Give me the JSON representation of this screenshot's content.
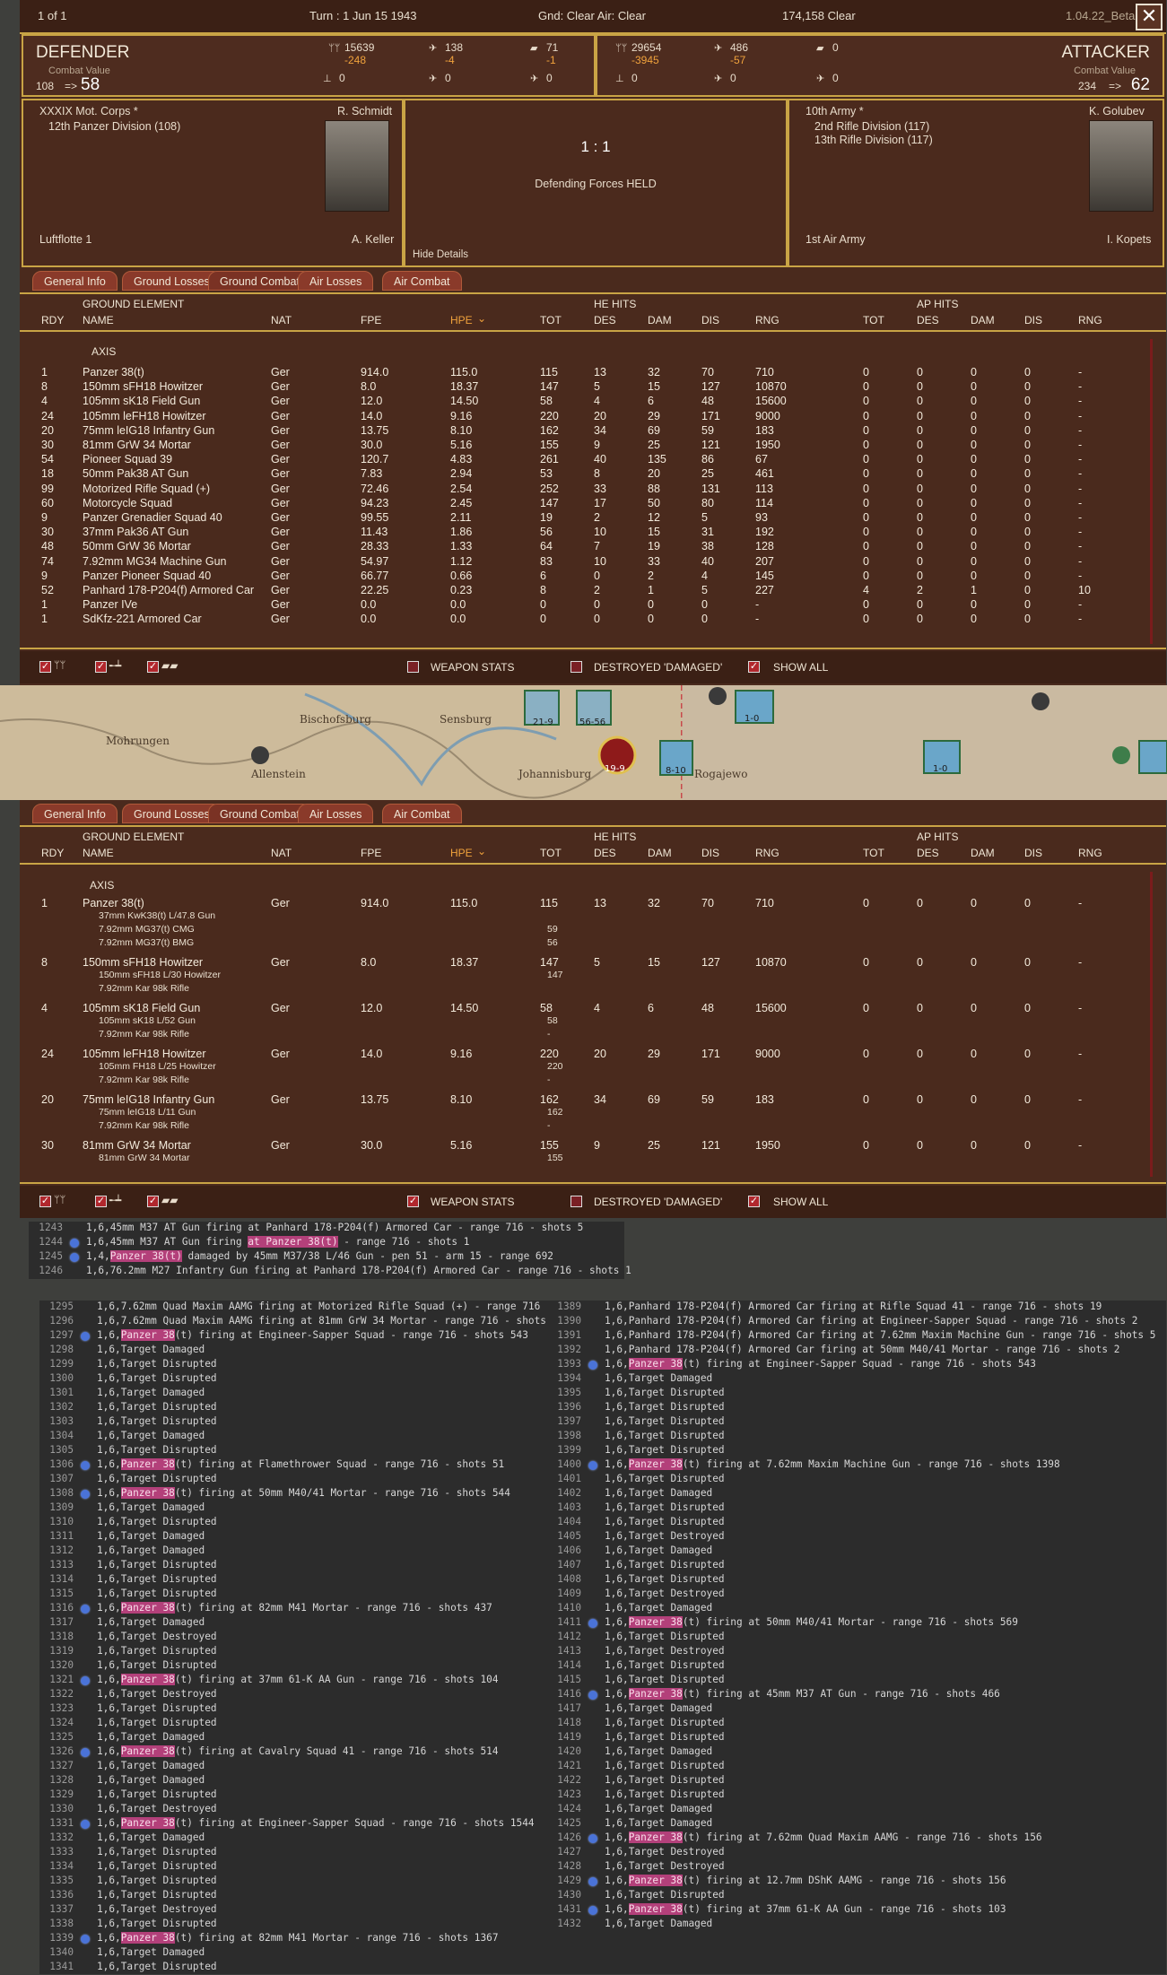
{
  "topbar": {
    "page": "1 of 1",
    "turn": "Turn : 1   Jun 15 1943",
    "weather": "Gnd: Clear  Air: Clear",
    "code": "174,158   Clear",
    "version": "1.04.22_Beta",
    "close": "✕"
  },
  "defender": {
    "title": "DEFENDER",
    "cv_label": "Combat Value",
    "cv_from": "108",
    "cv_arrow": "=>",
    "cv_to": "58",
    "men": "15639",
    "men_loss": "-248",
    "air": "138",
    "air_loss": "-4",
    "tank": "71",
    "tank_loss": "-1",
    "row2_a": "0",
    "row2_b": "0",
    "row2_c": "0",
    "corps": "XXXIX Mot. Corps *",
    "division": "12th Panzer Division (108)",
    "commander": "R. Schmidt",
    "air_unit": "Luftflotte 1",
    "air_commander": "A. Keller"
  },
  "attacker": {
    "title": "ATTACKER",
    "cv_label": "Combat Value",
    "cv_from": "234",
    "cv_arrow": "=>",
    "cv_to": "62",
    "men": "29654",
    "men_loss": "-3945",
    "air": "486",
    "air_loss": "-57",
    "tank": "0",
    "row2_a": "0",
    "row2_b": "0",
    "row2_c": "0",
    "army": "10th Army *",
    "div1": "2nd Rifle Division (117)",
    "div2": "13th Rifle Division (117)",
    "commander": "K. Golubev",
    "air_unit": "1st Air Army",
    "air_commander": "I. Kopets"
  },
  "center": {
    "odds": "1 : 1",
    "result": "Defending Forces HELD",
    "hide": "Hide Details"
  },
  "tabs": [
    "General Info",
    "Ground Losses",
    "Ground Combat",
    "Air Losses",
    "Air Combat"
  ],
  "table_headers": {
    "ground_element": "GROUND ELEMENT",
    "he_hits": "HE HITS",
    "ap_hits": "AP HITS",
    "cols": [
      "RDY",
      "NAME",
      "NAT",
      "FPE",
      "HPE",
      "TOT",
      "DES",
      "DAM",
      "DIS",
      "RNG",
      "TOT",
      "DES",
      "DAM",
      "DIS",
      "RNG"
    ],
    "hpe_sort": "⌄"
  },
  "side_label": "AXIS",
  "table1_rows": [
    [
      "1",
      "Panzer 38(t)",
      "Ger",
      "914.0",
      "115.0",
      "115",
      "13",
      "32",
      "70",
      "710",
      "0",
      "0",
      "0",
      "0",
      "-"
    ],
    [
      "8",
      "150mm sFH18 Howitzer",
      "Ger",
      "8.0",
      "18.37",
      "147",
      "5",
      "15",
      "127",
      "10870",
      "0",
      "0",
      "0",
      "0",
      "-"
    ],
    [
      "4",
      "105mm sK18 Field Gun",
      "Ger",
      "12.0",
      "14.50",
      "58",
      "4",
      "6",
      "48",
      "15600",
      "0",
      "0",
      "0",
      "0",
      "-"
    ],
    [
      "24",
      "105mm leFH18 Howitzer",
      "Ger",
      "14.0",
      "9.16",
      "220",
      "20",
      "29",
      "171",
      "9000",
      "0",
      "0",
      "0",
      "0",
      "-"
    ],
    [
      "20",
      "75mm leIG18 Infantry Gun",
      "Ger",
      "13.75",
      "8.10",
      "162",
      "34",
      "69",
      "59",
      "183",
      "0",
      "0",
      "0",
      "0",
      "-"
    ],
    [
      "30",
      "81mm GrW 34 Mortar",
      "Ger",
      "30.0",
      "5.16",
      "155",
      "9",
      "25",
      "121",
      "1950",
      "0",
      "0",
      "0",
      "0",
      "-"
    ],
    [
      "54",
      "Pioneer Squad 39",
      "Ger",
      "120.7",
      "4.83",
      "261",
      "40",
      "135",
      "86",
      "67",
      "0",
      "0",
      "0",
      "0",
      "-"
    ],
    [
      "18",
      "50mm Pak38 AT Gun",
      "Ger",
      "7.83",
      "2.94",
      "53",
      "8",
      "20",
      "25",
      "461",
      "0",
      "0",
      "0",
      "0",
      "-"
    ],
    [
      "99",
      "Motorized Rifle Squad (+)",
      "Ger",
      "72.46",
      "2.54",
      "252",
      "33",
      "88",
      "131",
      "113",
      "0",
      "0",
      "0",
      "0",
      "-"
    ],
    [
      "60",
      "Motorcycle Squad",
      "Ger",
      "94.23",
      "2.45",
      "147",
      "17",
      "50",
      "80",
      "114",
      "0",
      "0",
      "0",
      "0",
      "-"
    ],
    [
      "9",
      "Panzer Grenadier Squad 40",
      "Ger",
      "99.55",
      "2.11",
      "19",
      "2",
      "12",
      "5",
      "93",
      "0",
      "0",
      "0",
      "0",
      "-"
    ],
    [
      "30",
      "37mm Pak36 AT Gun",
      "Ger",
      "11.43",
      "1.86",
      "56",
      "10",
      "15",
      "31",
      "192",
      "0",
      "0",
      "0",
      "0",
      "-"
    ],
    [
      "48",
      "50mm GrW 36 Mortar",
      "Ger",
      "28.33",
      "1.33",
      "64",
      "7",
      "19",
      "38",
      "128",
      "0",
      "0",
      "0",
      "0",
      "-"
    ],
    [
      "74",
      "7.92mm MG34 Machine Gun",
      "Ger",
      "54.97",
      "1.12",
      "83",
      "10",
      "33",
      "40",
      "207",
      "0",
      "0",
      "0",
      "0",
      "-"
    ],
    [
      "9",
      "Panzer Pioneer Squad 40",
      "Ger",
      "66.77",
      "0.66",
      "6",
      "0",
      "2",
      "4",
      "145",
      "0",
      "0",
      "0",
      "0",
      "-"
    ],
    [
      "52",
      "Panhard 178-P204(f) Armored Car",
      "Ger",
      "22.25",
      "0.23",
      "8",
      "2",
      "1",
      "5",
      "227",
      "4",
      "2",
      "1",
      "0",
      "10"
    ],
    [
      "1",
      "Panzer IVe",
      "Ger",
      "0.0",
      "0.0",
      "0",
      "0",
      "0",
      "0",
      "-",
      "0",
      "0",
      "0",
      "0",
      "-"
    ],
    [
      "1",
      "SdKfz-221 Armored Car",
      "Ger",
      "0.0",
      "0.0",
      "0",
      "0",
      "0",
      "0",
      "-",
      "0",
      "0",
      "0",
      "0",
      "-"
    ]
  ],
  "table2_rows": [
    {
      "main": [
        "1",
        "Panzer 38(t)",
        "Ger",
        "914.0",
        "115.0",
        "115",
        "13",
        "32",
        "70",
        "710",
        "0",
        "0",
        "0",
        "0",
        "-"
      ],
      "subs": [
        [
          "37mm KwK38(t) L/47.8 Gun",
          "",
          ""
        ],
        [
          "7.92mm MG37(t) CMG",
          "59",
          ""
        ],
        [
          "7.92mm MG37(t) BMG",
          "56",
          ""
        ]
      ]
    },
    {
      "main": [
        "8",
        "150mm sFH18 Howitzer",
        "Ger",
        "8.0",
        "18.37",
        "147",
        "5",
        "15",
        "127",
        "10870",
        "0",
        "0",
        "0",
        "0",
        "-"
      ],
      "subs": [
        [
          "150mm sFH18 L/30 Howitzer",
          "147",
          ""
        ],
        [
          "7.92mm Kar 98k Rifle",
          "",
          ""
        ]
      ]
    },
    {
      "main": [
        "4",
        "105mm sK18 Field Gun",
        "Ger",
        "12.0",
        "14.50",
        "58",
        "4",
        "6",
        "48",
        "15600",
        "0",
        "0",
        "0",
        "0",
        "-"
      ],
      "subs": [
        [
          "105mm sK18 L/52 Gun",
          "58",
          ""
        ],
        [
          "7.92mm Kar 98k Rifle",
          "-",
          ""
        ]
      ]
    },
    {
      "main": [
        "24",
        "105mm leFH18 Howitzer",
        "Ger",
        "14.0",
        "9.16",
        "220",
        "20",
        "29",
        "171",
        "9000",
        "0",
        "0",
        "0",
        "0",
        "-"
      ],
      "subs": [
        [
          "105mm FH18 L/25 Howitzer",
          "220",
          ""
        ],
        [
          "7.92mm Kar 98k Rifle",
          "-",
          ""
        ]
      ]
    },
    {
      "main": [
        "20",
        "75mm leIG18 Infantry Gun",
        "Ger",
        "13.75",
        "8.10",
        "162",
        "34",
        "69",
        "59",
        "183",
        "0",
        "0",
        "0",
        "0",
        "-"
      ],
      "subs": [
        [
          "75mm leIG18 L/11 Gun",
          "162",
          ""
        ],
        [
          "7.92mm Kar 98k Rifle",
          "-",
          ""
        ]
      ]
    },
    {
      "main": [
        "30",
        "81mm GrW 34 Mortar",
        "Ger",
        "30.0",
        "5.16",
        "155",
        "9",
        "25",
        "121",
        "1950",
        "0",
        "0",
        "0",
        "0",
        "-"
      ],
      "subs": [
        [
          "81mm GrW 34 Mortar",
          "155",
          ""
        ]
      ]
    }
  ],
  "footer": {
    "weapon_stats": "WEAPON STATS",
    "destroyed": "DESTROYED 'DAMAGED'",
    "show_all": "SHOW ALL"
  },
  "map": {
    "cities": [
      "Bischofsburg",
      "Sensburg",
      "Allenstein",
      "Johannisburg",
      "Mohrungen",
      "Rogajewo"
    ],
    "units": [
      "21-9",
      "56-56",
      "19-9",
      "8-10",
      "1-0",
      "1-0"
    ]
  },
  "log_small": [
    {
      "n": "1243",
      "bp": false,
      "t": "1,6,45mm M37 AT Gun firing at Panhard 178-P204(f) Armored Car - range 716 - shots 5"
    },
    {
      "n": "1244",
      "bp": true,
      "t": "1,6,45mm M37 AT Gun firing at Panzer 38(t) - range 716 - shots 1",
      "hl": "at Panzer 38(t)"
    },
    {
      "n": "1245",
      "bp": true,
      "t": "1,4,Panzer 38(t) damaged by 45mm M37/38 L/46 Gun - pen 51 - arm 15 - range 692",
      "hl": "Panzer 38(t)"
    },
    {
      "n": "1246",
      "bp": false,
      "t": "1,6,76.2mm M27 Infantry Gun firing at Panhard 178-P204(f) Armored Car - range 716 - shots 1"
    }
  ],
  "log_left": [
    {
      "n": "1295",
      "bp": false,
      "t": "1,6,7.62mm Quad Maxim AAMG firing at Motorized Rifle Squad (+) - range 716 -"
    },
    {
      "n": "1296",
      "bp": false,
      "t": "1,6,7.62mm Quad Maxim AAMG firing at 81mm GrW 34 Mortar - range 716 - shots"
    },
    {
      "n": "1297",
      "bp": true,
      "t": "1,6,Panzer 38(t) firing at Engineer-Sapper Squad - range 716 - shots 543",
      "hl": "Panzer 38"
    },
    {
      "n": "1298",
      "bp": false,
      "t": "1,6,Target Damaged"
    },
    {
      "n": "1299",
      "bp": false,
      "t": "1,6,Target Disrupted"
    },
    {
      "n": "1300",
      "bp": false,
      "t": "1,6,Target Disrupted"
    },
    {
      "n": "1301",
      "bp": false,
      "t": "1,6,Target Damaged"
    },
    {
      "n": "1302",
      "bp": false,
      "t": "1,6,Target Disrupted"
    },
    {
      "n": "1303",
      "bp": false,
      "t": "1,6,Target Disrupted"
    },
    {
      "n": "1304",
      "bp": false,
      "t": "1,6,Target Damaged"
    },
    {
      "n": "1305",
      "bp": false,
      "t": "1,6,Target Disrupted"
    },
    {
      "n": "1306",
      "bp": true,
      "t": "1,6,Panzer 38(t) firing at Flamethrower Squad - range 716 - shots 51",
      "hl": "Panzer 38"
    },
    {
      "n": "1307",
      "bp": false,
      "t": "1,6,Target Disrupted"
    },
    {
      "n": "1308",
      "bp": true,
      "t": "1,6,Panzer 38(t) firing at 50mm M40/41 Mortar - range 716 - shots 544",
      "hl": "Panzer 38"
    },
    {
      "n": "1309",
      "bp": false,
      "t": "1,6,Target Damaged"
    },
    {
      "n": "1310",
      "bp": false,
      "t": "1,6,Target Disrupted"
    },
    {
      "n": "1311",
      "bp": false,
      "t": "1,6,Target Damaged"
    },
    {
      "n": "1312",
      "bp": false,
      "t": "1,6,Target Damaged"
    },
    {
      "n": "1313",
      "bp": false,
      "t": "1,6,Target Disrupted"
    },
    {
      "n": "1314",
      "bp": false,
      "t": "1,6,Target Disrupted"
    },
    {
      "n": "1315",
      "bp": false,
      "t": "1,6,Target Disrupted"
    },
    {
      "n": "1316",
      "bp": true,
      "t": "1,6,Panzer 38(t) firing at 82mm M41 Mortar - range 716 - shots 437",
      "hl": "Panzer 38"
    },
    {
      "n": "1317",
      "bp": false,
      "t": "1,6,Target Damaged"
    },
    {
      "n": "1318",
      "bp": false,
      "t": "1,6,Target Destroyed"
    },
    {
      "n": "1319",
      "bp": false,
      "t": "1,6,Target Disrupted"
    },
    {
      "n": "1320",
      "bp": false,
      "t": "1,6,Target Disrupted"
    },
    {
      "n": "1321",
      "bp": true,
      "t": "1,6,Panzer 38(t) firing at 37mm 61-K AA Gun - range 716 - shots 104",
      "hl": "Panzer 38"
    },
    {
      "n": "1322",
      "bp": false,
      "t": "1,6,Target Destroyed"
    },
    {
      "n": "1323",
      "bp": false,
      "t": "1,6,Target Disrupted"
    },
    {
      "n": "1324",
      "bp": false,
      "t": "1,6,Target Disrupted"
    },
    {
      "n": "1325",
      "bp": false,
      "t": "1,6,Target Damaged"
    },
    {
      "n": "1326",
      "bp": true,
      "t": "1,6,Panzer 38(t) firing at Cavalry Squad 41 - range 716 - shots 514",
      "hl": "Panzer 38"
    },
    {
      "n": "1327",
      "bp": false,
      "t": "1,6,Target Damaged"
    },
    {
      "n": "1328",
      "bp": false,
      "t": "1,6,Target Damaged"
    },
    {
      "n": "1329",
      "bp": false,
      "t": "1,6,Target Disrupted"
    },
    {
      "n": "1330",
      "bp": false,
      "t": "1,6,Target Destroyed"
    },
    {
      "n": "1331",
      "bp": true,
      "t": "1,6,Panzer 38(t) firing at Engineer-Sapper Squad - range 716 - shots 1544",
      "hl": "Panzer 38"
    },
    {
      "n": "1332",
      "bp": false,
      "t": "1,6,Target Damaged"
    },
    {
      "n": "1333",
      "bp": false,
      "t": "1,6,Target Disrupted"
    },
    {
      "n": "1334",
      "bp": false,
      "t": "1,6,Target Disrupted"
    },
    {
      "n": "1335",
      "bp": false,
      "t": "1,6,Target Disrupted"
    },
    {
      "n": "1336",
      "bp": false,
      "t": "1,6,Target Disrupted"
    },
    {
      "n": "1337",
      "bp": false,
      "t": "1,6,Target Destroyed"
    },
    {
      "n": "1338",
      "bp": false,
      "t": "1,6,Target Disrupted"
    },
    {
      "n": "1339",
      "bp": true,
      "t": "1,6,Panzer 38(t) firing at 82mm M41 Mortar - range 716 - shots 1367",
      "hl": "Panzer 38"
    },
    {
      "n": "1340",
      "bp": false,
      "t": "1,6,Target Damaged"
    },
    {
      "n": "1341",
      "bp": false,
      "t": "1,6,Target Disrupted"
    }
  ],
  "log_right": [
    {
      "n": "1389",
      "bp": false,
      "t": "1,6,Panhard 178-P204(f) Armored Car firing at Rifle Squad 41 - range 716 - shots 19"
    },
    {
      "n": "1390",
      "bp": false,
      "t": "1,6,Panhard 178-P204(f) Armored Car firing at Engineer-Sapper Squad - range 716 - shots 2"
    },
    {
      "n": "1391",
      "bp": false,
      "t": "1,6,Panhard 178-P204(f) Armored Car firing at 7.62mm Maxim Machine Gun - range 716 - shots 5"
    },
    {
      "n": "1392",
      "bp": false,
      "t": "1,6,Panhard 178-P204(f) Armored Car firing at 50mm M40/41 Mortar - range 716 - shots 2"
    },
    {
      "n": "1393",
      "bp": true,
      "t": "1,6,Panzer 38(t) firing at Engineer-Sapper Squad - range 716 - shots 543",
      "hl": "Panzer 38"
    },
    {
      "n": "1394",
      "bp": false,
      "t": "1,6,Target Damaged"
    },
    {
      "n": "1395",
      "bp": false,
      "t": "1,6,Target Disrupted"
    },
    {
      "n": "1396",
      "bp": false,
      "t": "1,6,Target Disrupted"
    },
    {
      "n": "1397",
      "bp": false,
      "t": "1,6,Target Disrupted"
    },
    {
      "n": "1398",
      "bp": false,
      "t": "1,6,Target Disrupted"
    },
    {
      "n": "1399",
      "bp": false,
      "t": "1,6,Target Disrupted"
    },
    {
      "n": "1400",
      "bp": true,
      "t": "1,6,Panzer 38(t) firing at 7.62mm Maxim Machine Gun - range 716 - shots 1398",
      "hl": "Panzer 38"
    },
    {
      "n": "1401",
      "bp": false,
      "t": "1,6,Target Disrupted"
    },
    {
      "n": "1402",
      "bp": false,
      "t": "1,6,Target Damaged"
    },
    {
      "n": "1403",
      "bp": false,
      "t": "1,6,Target Disrupted"
    },
    {
      "n": "1404",
      "bp": false,
      "t": "1,6,Target Disrupted"
    },
    {
      "n": "1405",
      "bp": false,
      "t": "1,6,Target Destroyed"
    },
    {
      "n": "1406",
      "bp": false,
      "t": "1,6,Target Damaged"
    },
    {
      "n": "1407",
      "bp": false,
      "t": "1,6,Target Disrupted"
    },
    {
      "n": "1408",
      "bp": false,
      "t": "1,6,Target Disrupted"
    },
    {
      "n": "1409",
      "bp": false,
      "t": "1,6,Target Destroyed"
    },
    {
      "n": "1410",
      "bp": false,
      "t": "1,6,Target Damaged"
    },
    {
      "n": "1411",
      "bp": true,
      "t": "1,6,Panzer 38(t) firing at 50mm M40/41 Mortar - range 716 - shots 569",
      "hl": "Panzer 38"
    },
    {
      "n": "1412",
      "bp": false,
      "t": "1,6,Target Disrupted"
    },
    {
      "n": "1413",
      "bp": false,
      "t": "1,6,Target Destroyed"
    },
    {
      "n": "1414",
      "bp": false,
      "t": "1,6,Target Disrupted"
    },
    {
      "n": "1415",
      "bp": false,
      "t": "1,6,Target Disrupted"
    },
    {
      "n": "1416",
      "bp": true,
      "t": "1,6,Panzer 38(t) firing at 45mm M37 AT Gun - range 716 - shots 466",
      "hl": "Panzer 38"
    },
    {
      "n": "1417",
      "bp": false,
      "t": "1,6,Target Damaged"
    },
    {
      "n": "1418",
      "bp": false,
      "t": "1,6,Target Disrupted"
    },
    {
      "n": "1419",
      "bp": false,
      "t": "1,6,Target Disrupted"
    },
    {
      "n": "1420",
      "bp": false,
      "t": "1,6,Target Damaged"
    },
    {
      "n": "1421",
      "bp": false,
      "t": "1,6,Target Disrupted"
    },
    {
      "n": "1422",
      "bp": false,
      "t": "1,6,Target Disrupted"
    },
    {
      "n": "1423",
      "bp": false,
      "t": "1,6,Target Disrupted"
    },
    {
      "n": "1424",
      "bp": false,
      "t": "1,6,Target Damaged"
    },
    {
      "n": "1425",
      "bp": false,
      "t": "1,6,Target Damaged"
    },
    {
      "n": "1426",
      "bp": true,
      "t": "1,6,Panzer 38(t) firing at 7.62mm Quad Maxim AAMG - range 716 - shots 156",
      "hl": "Panzer 38"
    },
    {
      "n": "1427",
      "bp": false,
      "t": "1,6,Target Destroyed"
    },
    {
      "n": "1428",
      "bp": false,
      "t": "1,6,Target Destroyed"
    },
    {
      "n": "1429",
      "bp": true,
      "t": "1,6,Panzer 38(t) firing at 12.7mm DShK AAMG - range 716 - shots 156",
      "hl": "Panzer 38"
    },
    {
      "n": "1430",
      "bp": false,
      "t": "1,6,Target Disrupted"
    },
    {
      "n": "1431",
      "bp": true,
      "t": "1,6,Panzer 38(t) firing at 37mm 61-K AA Gun - range 716 - shots 103",
      "hl": "Panzer 38"
    },
    {
      "n": "1432",
      "bp": false,
      "t": "1,6,Target Damaged"
    }
  ],
  "colors": {
    "panel": "#4a2a1d",
    "gold": "#c9a445",
    "orange": "#f0a23c",
    "breakpoint": "#4a73d8",
    "highlight": "#b3407a"
  }
}
